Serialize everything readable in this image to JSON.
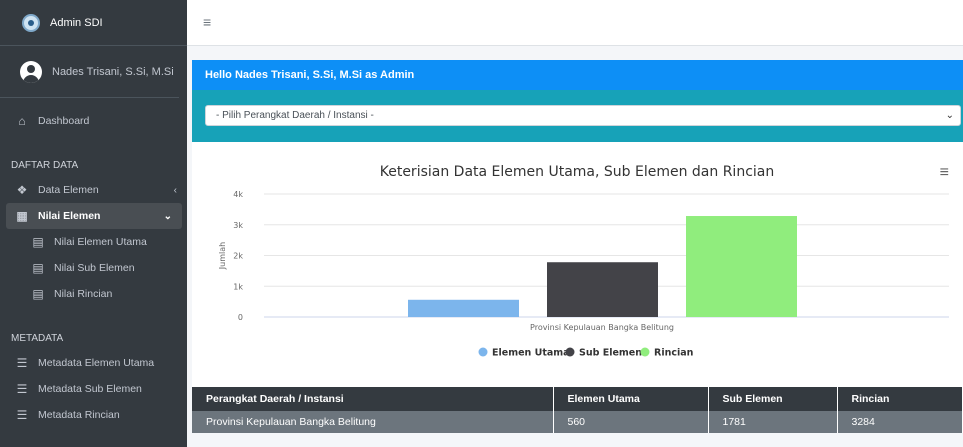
{
  "brand": {
    "title": "Admin SDI"
  },
  "user": {
    "name": "Nades Trisani, S.Si, M.Si"
  },
  "sidebar": {
    "dashboard": "Dashboard",
    "section_data": "DAFTAR DATA",
    "data_elemen": "Data Elemen",
    "nilai_elemen": "Nilai Elemen",
    "nilai_elemen_utama": "Nilai Elemen Utama",
    "nilai_sub_elemen": "Nilai Sub Elemen",
    "nilai_rincian": "Nilai Rincian",
    "section_meta": "METADATA",
    "meta_utama": "Metadata Elemen Utama",
    "meta_sub": "Metadata Sub Elemen",
    "meta_rincian": "Metadata Rincian"
  },
  "header": {
    "greeting": "Hello Nades Trisani, S.Si, M.Si as Admin"
  },
  "filter": {
    "selected": "- Pilih Perangkat Daerah / Instansi -"
  },
  "chart_data": {
    "type": "bar",
    "title": "Keterisian Data Elemen Utama, Sub Elemen dan Rincian",
    "ylabel": "Jumlah",
    "xlabel": "",
    "categories": [
      "Provinsi Kepulauan Bangka Belitung"
    ],
    "yticks": [
      "0",
      "1k",
      "2k",
      "3k",
      "4k"
    ],
    "ylim": [
      0,
      4000
    ],
    "legend_position": "bottom",
    "series": [
      {
        "name": "Elemen Utama",
        "values": [
          560
        ],
        "color": "#7cb5ec"
      },
      {
        "name": "Sub Elemen",
        "values": [
          1781
        ],
        "color": "#434348"
      },
      {
        "name": "Rincian",
        "values": [
          3284
        ],
        "color": "#90ed7d"
      }
    ]
  },
  "table": {
    "headers": [
      "Perangkat Daerah / Instansi",
      "Elemen Utama",
      "Sub Elemen",
      "Rincian"
    ],
    "rows": [
      [
        "Provinsi Kepulauan Bangka Belitung",
        "560",
        "1781",
        "3284"
      ]
    ]
  }
}
